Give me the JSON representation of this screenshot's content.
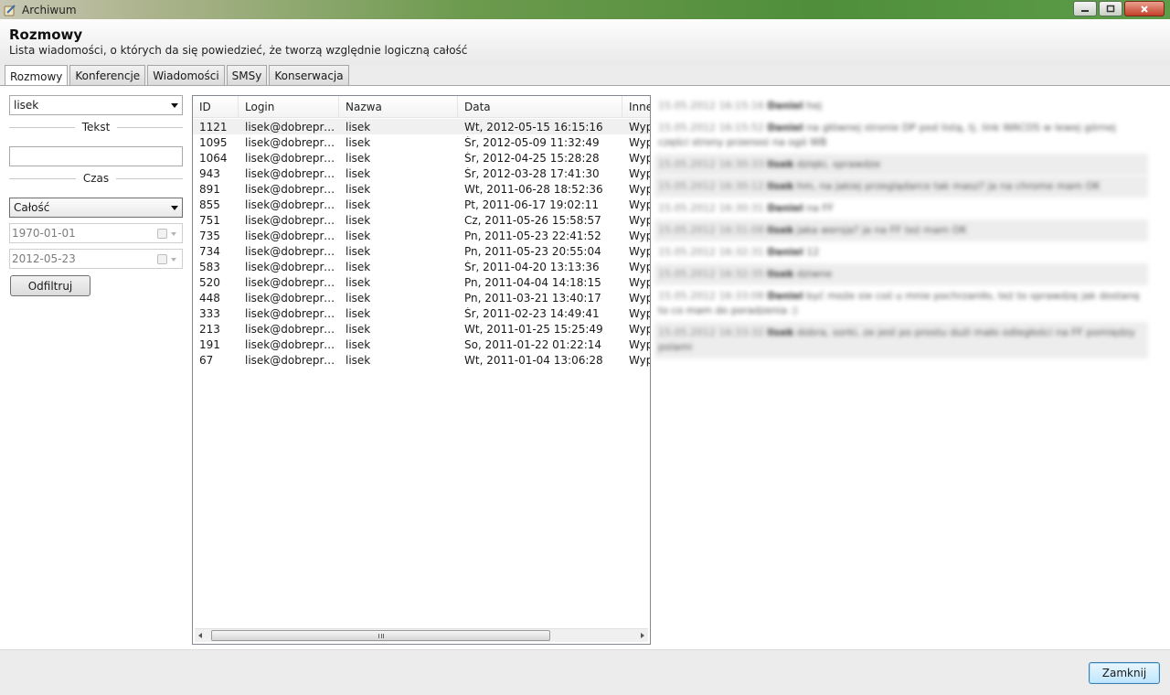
{
  "window": {
    "title": "Archiwum",
    "controls": {
      "minimize_icon": "minimize-icon",
      "maximize_icon": "maximize-icon",
      "close_icon": "close-icon"
    }
  },
  "header": {
    "title": "Rozmowy",
    "subtitle": "Lista wiadomości, o których da się powiedzieć, że tworzą względnie logiczną całość"
  },
  "tabs": [
    {
      "label": "Rozmowy",
      "active": true
    },
    {
      "label": "Konferencje"
    },
    {
      "label": "Wiadomości"
    },
    {
      "label": "SMSy"
    },
    {
      "label": "Konserwacja"
    }
  ],
  "filters": {
    "user_select": "lisek",
    "text_label": "Tekst",
    "text_value": "",
    "time_label": "Czas",
    "time_select": "Całość",
    "date_from": "1970-01-01",
    "date_to": "2012-05-23",
    "filter_button": "Odfiltruj"
  },
  "table": {
    "columns": [
      "ID",
      "Login",
      "Nazwa",
      "Data",
      "Inne"
    ],
    "rows": [
      {
        "id": "1121",
        "login": "lisek@dobreprogramy.pl",
        "name": "lisek",
        "date": "Wt, 2012-05-15 16:15:16",
        "other": "Wyp",
        "selected": true
      },
      {
        "id": "1095",
        "login": "lisek@dobreprogramy.pl",
        "name": "lisek",
        "date": "Śr, 2012-05-09 11:32:49",
        "other": "Wyp"
      },
      {
        "id": "1064",
        "login": "lisek@dobreprogramy.pl",
        "name": "lisek",
        "date": "Śr, 2012-04-25 15:28:28",
        "other": "Wyp"
      },
      {
        "id": "943",
        "login": "lisek@dobreprogramy.pl",
        "name": "lisek",
        "date": "Śr, 2012-03-28 17:41:30",
        "other": "Wyp"
      },
      {
        "id": "891",
        "login": "lisek@dobreprogramy.pl",
        "name": "lisek",
        "date": "Wt, 2011-06-28 18:52:36",
        "other": "Wyp"
      },
      {
        "id": "855",
        "login": "lisek@dobreprogramy.pl",
        "name": "lisek",
        "date": "Pt, 2011-06-17 19:02:11",
        "other": "Wyp"
      },
      {
        "id": "751",
        "login": "lisek@dobreprogramy.pl",
        "name": "lisek",
        "date": "Cz, 2011-05-26 15:58:57",
        "other": "Wyp"
      },
      {
        "id": "735",
        "login": "lisek@dobreprogramy.pl",
        "name": "lisek",
        "date": "Pn, 2011-05-23 22:41:52",
        "other": "Wyp"
      },
      {
        "id": "734",
        "login": "lisek@dobreprogramy.pl",
        "name": "lisek",
        "date": "Pn, 2011-05-23 20:55:04",
        "other": "Wyp"
      },
      {
        "id": "583",
        "login": "lisek@dobreprogramy.pl",
        "name": "lisek",
        "date": "Śr, 2011-04-20 13:13:36",
        "other": "Wyp"
      },
      {
        "id": "520",
        "login": "lisek@dobreprogramy.pl",
        "name": "lisek",
        "date": "Pn, 2011-04-04 14:18:15",
        "other": "Wyp"
      },
      {
        "id": "448",
        "login": "lisek@dobreprogramy.pl",
        "name": "lisek",
        "date": "Pn, 2011-03-21 13:40:17",
        "other": "Wyp"
      },
      {
        "id": "333",
        "login": "lisek@dobreprogramy.pl",
        "name": "lisek",
        "date": "Śr, 2011-02-23 14:49:41",
        "other": "Wyp"
      },
      {
        "id": "213",
        "login": "lisek@dobreprogramy.pl",
        "name": "lisek",
        "date": "Wt, 2011-01-25 15:25:49",
        "other": "Wyp"
      },
      {
        "id": "191",
        "login": "lisek@dobreprogramy.pl",
        "name": "lisek",
        "date": "So, 2011-01-22 01:22:14",
        "other": "Wyp"
      },
      {
        "id": "67",
        "login": "lisek@dobreprogramy.pl",
        "name": "lisek",
        "date": "Wt, 2011-01-04 13:06:28",
        "other": "Wyp"
      }
    ]
  },
  "messages": [
    {
      "ts": "15.05.2012 16:15:16",
      "nick": "Daniel",
      "text": "hej",
      "shaded": false
    },
    {
      "ts": "15.05.2012 16:15:52",
      "nick": "Daniel",
      "text": "na głównej stronie DP pod listą, tj. link WACOS w lewej górnej części strony przenosi na ogó WB",
      "shaded": false
    },
    {
      "ts": "15.05.2012 16:30:33",
      "nick": "lisek",
      "text": "dzięki, sprawdze",
      "shaded": true
    },
    {
      "ts": "15.05.2012 16:30:12",
      "nick": "lisek",
      "text": "hm, na jakiej przeglądarce tak masz? ja na chrome mam OK",
      "shaded": true
    },
    {
      "ts": "15.05.2012 16:30:31",
      "nick": "Daniel",
      "text": "na FF",
      "shaded": false
    },
    {
      "ts": "15.05.2012 16:31:08",
      "nick": "lisek",
      "text": "jaka wersja? ja na FF też mam OK",
      "shaded": true
    },
    {
      "ts": "15.05.2012 16:32:31",
      "nick": "Daniel",
      "text": "12",
      "shaded": false
    },
    {
      "ts": "15.05.2012 16:32:35",
      "nick": "lisek",
      "text": "dziwne",
      "shaded": true
    },
    {
      "ts": "15.05.2012 16:33:08",
      "nick": "Daniel",
      "text": "być może sie coś u mnie pochrzaniło, też to sprawdzę jak dostanę to co mam do poradzenia :)",
      "shaded": false
    },
    {
      "ts": "15.05.2012 16:33:32",
      "nick": "lisek",
      "text": "dobra, sorki, ze jest po prostu dużi mało odległości na FF pomiędzy polami",
      "shaded": true
    }
  ],
  "footer": {
    "close_button": "Zamknij"
  }
}
